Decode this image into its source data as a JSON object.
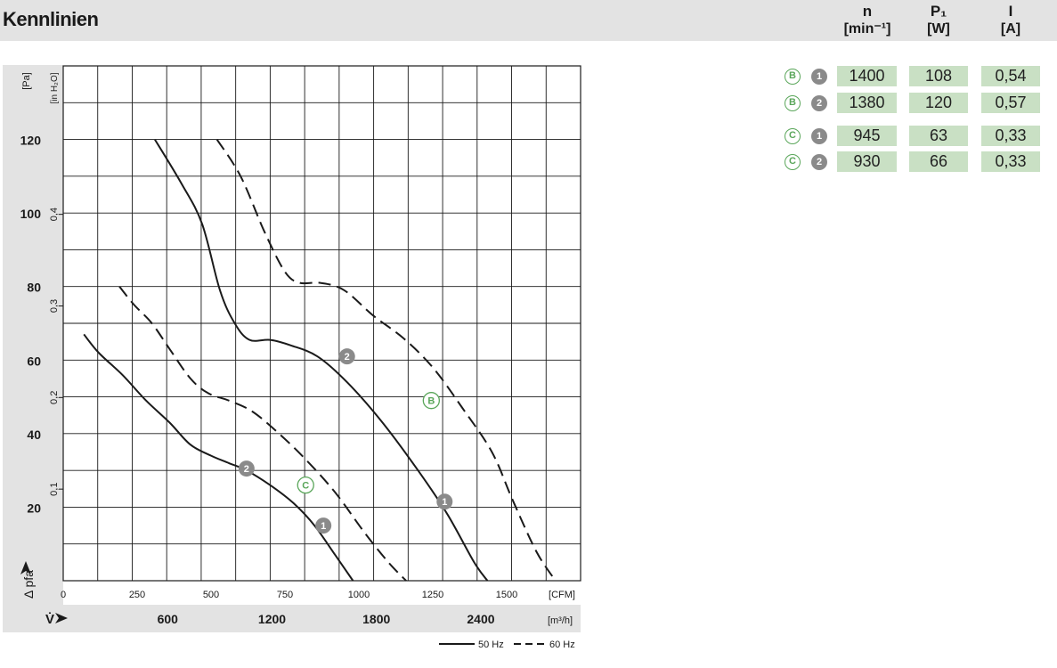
{
  "title": "Kennlinien",
  "table": {
    "headers": [
      {
        "name": "n",
        "unit": "[min⁻¹]"
      },
      {
        "name": "P₁",
        "unit": "[W]"
      },
      {
        "name": "I",
        "unit": "[A]"
      }
    ],
    "rows": [
      {
        "curve": "B",
        "point": "1",
        "n": "1400",
        "p1": "108",
        "i": "0,54"
      },
      {
        "curve": "B",
        "point": "2",
        "n": "1380",
        "p1": "120",
        "i": "0,57"
      },
      {
        "curve": "C",
        "point": "1",
        "n": "945",
        "p1": "63",
        "i": "0,33"
      },
      {
        "curve": "C",
        "point": "2",
        "n": "930",
        "p1": "66",
        "i": "0,33"
      }
    ]
  },
  "colors": {
    "panel": "#e3e3e3",
    "cell": "#c9e0c4",
    "curve": "#1a1a1a",
    "point_badge": "#8a8a8a",
    "letter_badge": "#5aa65a"
  },
  "chart_data": {
    "type": "line",
    "title": "",
    "ylabel": "Δ pfa",
    "y_unit_pa": "[Pa]",
    "y_unit_inh2o": "[in H₂O]",
    "x_unit_cfm": "[CFM]",
    "x_unit_m3h": "[m³/h]",
    "xlabel": "V̇",
    "xlim_cfm": [
      0,
      1750
    ],
    "ylim_pa": [
      0,
      140
    ],
    "pa_ticks": [
      20,
      40,
      60,
      80,
      100,
      120
    ],
    "inh2o_ticks": [
      "0,1",
      "0,2",
      "0,3",
      "0,4"
    ],
    "inh2o_values": [
      0.1,
      0.2,
      0.3,
      0.4
    ],
    "cfm_ticks": [
      "0",
      "250",
      "500",
      "750",
      "1000",
      "1250",
      "1500"
    ],
    "m3h_ticks": [
      "600",
      "1200",
      "1800",
      "2400"
    ],
    "m3h_values": [
      600,
      1200,
      1800,
      2400
    ],
    "grid": true,
    "legend": [
      {
        "label": "50 Hz",
        "style": "solid"
      },
      {
        "label": "60 Hz",
        "style": "dashed"
      }
    ],
    "series": [
      {
        "id": "B-50Hz",
        "style": "solid",
        "points": [
          [
            310,
            120
          ],
          [
            400,
            108
          ],
          [
            470,
            97
          ],
          [
            530,
            79
          ],
          [
            580,
            70
          ],
          [
            630,
            65.5
          ],
          [
            700,
            65.5
          ],
          [
            770,
            64
          ],
          [
            860,
            61
          ],
          [
            960,
            54
          ],
          [
            1080,
            43
          ],
          [
            1200,
            30
          ],
          [
            1300,
            18
          ],
          [
            1390,
            5
          ],
          [
            1435,
            0
          ]
        ]
      },
      {
        "id": "B-60Hz",
        "style": "dashed",
        "points": [
          [
            520,
            120
          ],
          [
            600,
            110
          ],
          [
            680,
            95
          ],
          [
            750,
            84
          ],
          [
            800,
            81
          ],
          [
            870,
            81
          ],
          [
            950,
            79
          ],
          [
            1050,
            72
          ],
          [
            1150,
            66
          ],
          [
            1250,
            58
          ],
          [
            1350,
            47
          ],
          [
            1450,
            35
          ],
          [
            1520,
            22
          ],
          [
            1600,
            8
          ],
          [
            1665,
            0
          ]
        ]
      },
      {
        "id": "C-50Hz",
        "style": "solid",
        "points": [
          [
            70,
            67
          ],
          [
            120,
            62
          ],
          [
            200,
            56
          ],
          [
            280,
            49
          ],
          [
            360,
            43
          ],
          [
            430,
            37
          ],
          [
            500,
            34
          ],
          [
            560,
            32
          ],
          [
            620,
            30
          ],
          [
            700,
            26
          ],
          [
            780,
            21
          ],
          [
            850,
            15
          ],
          [
            920,
            7
          ],
          [
            980,
            0
          ]
        ]
      },
      {
        "id": "C-60Hz",
        "style": "dashed",
        "points": [
          [
            190,
            80
          ],
          [
            240,
            75
          ],
          [
            300,
            70
          ],
          [
            360,
            63
          ],
          [
            430,
            55
          ],
          [
            490,
            51
          ],
          [
            560,
            49
          ],
          [
            640,
            46
          ],
          [
            730,
            40
          ],
          [
            820,
            33
          ],
          [
            920,
            24
          ],
          [
            1020,
            13
          ],
          [
            1100,
            5
          ],
          [
            1160,
            0
          ]
        ]
      }
    ],
    "badges": [
      {
        "kind": "number",
        "text": "2",
        "x": 960,
        "y": 61
      },
      {
        "kind": "number",
        "text": "1",
        "x": 1290,
        "y": 21.5
      },
      {
        "kind": "number",
        "text": "2",
        "x": 620,
        "y": 30.5
      },
      {
        "kind": "number",
        "text": "1",
        "x": 880,
        "y": 15
      },
      {
        "kind": "letter",
        "text": "B",
        "x": 1245,
        "y": 49
      },
      {
        "kind": "letter",
        "text": "C",
        "x": 820,
        "y": 26
      }
    ]
  }
}
